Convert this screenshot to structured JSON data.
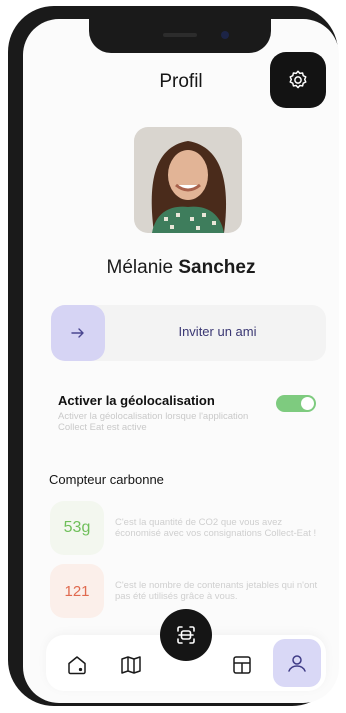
{
  "header": {
    "title": "Profil",
    "settings_icon": "gear-icon"
  },
  "user": {
    "first_name": "Mélanie",
    "last_name": "Sanchez"
  },
  "invite": {
    "label": "Inviter un ami",
    "icon": "arrow-right-icon",
    "accent": "#d6d4f4"
  },
  "geolocation": {
    "title": "Activer la géolocalisation",
    "description": "Activer la géolocalisation lorsque l'application Collect Eat est active",
    "enabled": true,
    "toggle_color": "#7ecb7f"
  },
  "carbon": {
    "title": "Compteur carbonne",
    "items": [
      {
        "value": "53g",
        "description": "C'est la quantité de CO2 que vous avez économisé avec vos consignations Collect-Eat !",
        "color": "#6fbf5a"
      },
      {
        "value": "121",
        "description": "C'est le nombre de contenants jetables qui n'ont pas été utilisés grâce à vous.",
        "color": "#e06a4f"
      }
    ]
  },
  "nav": {
    "items": [
      "home-icon",
      "map-icon",
      "scan-icon",
      "container-icon",
      "profile-icon"
    ],
    "active": "profile-icon"
  }
}
